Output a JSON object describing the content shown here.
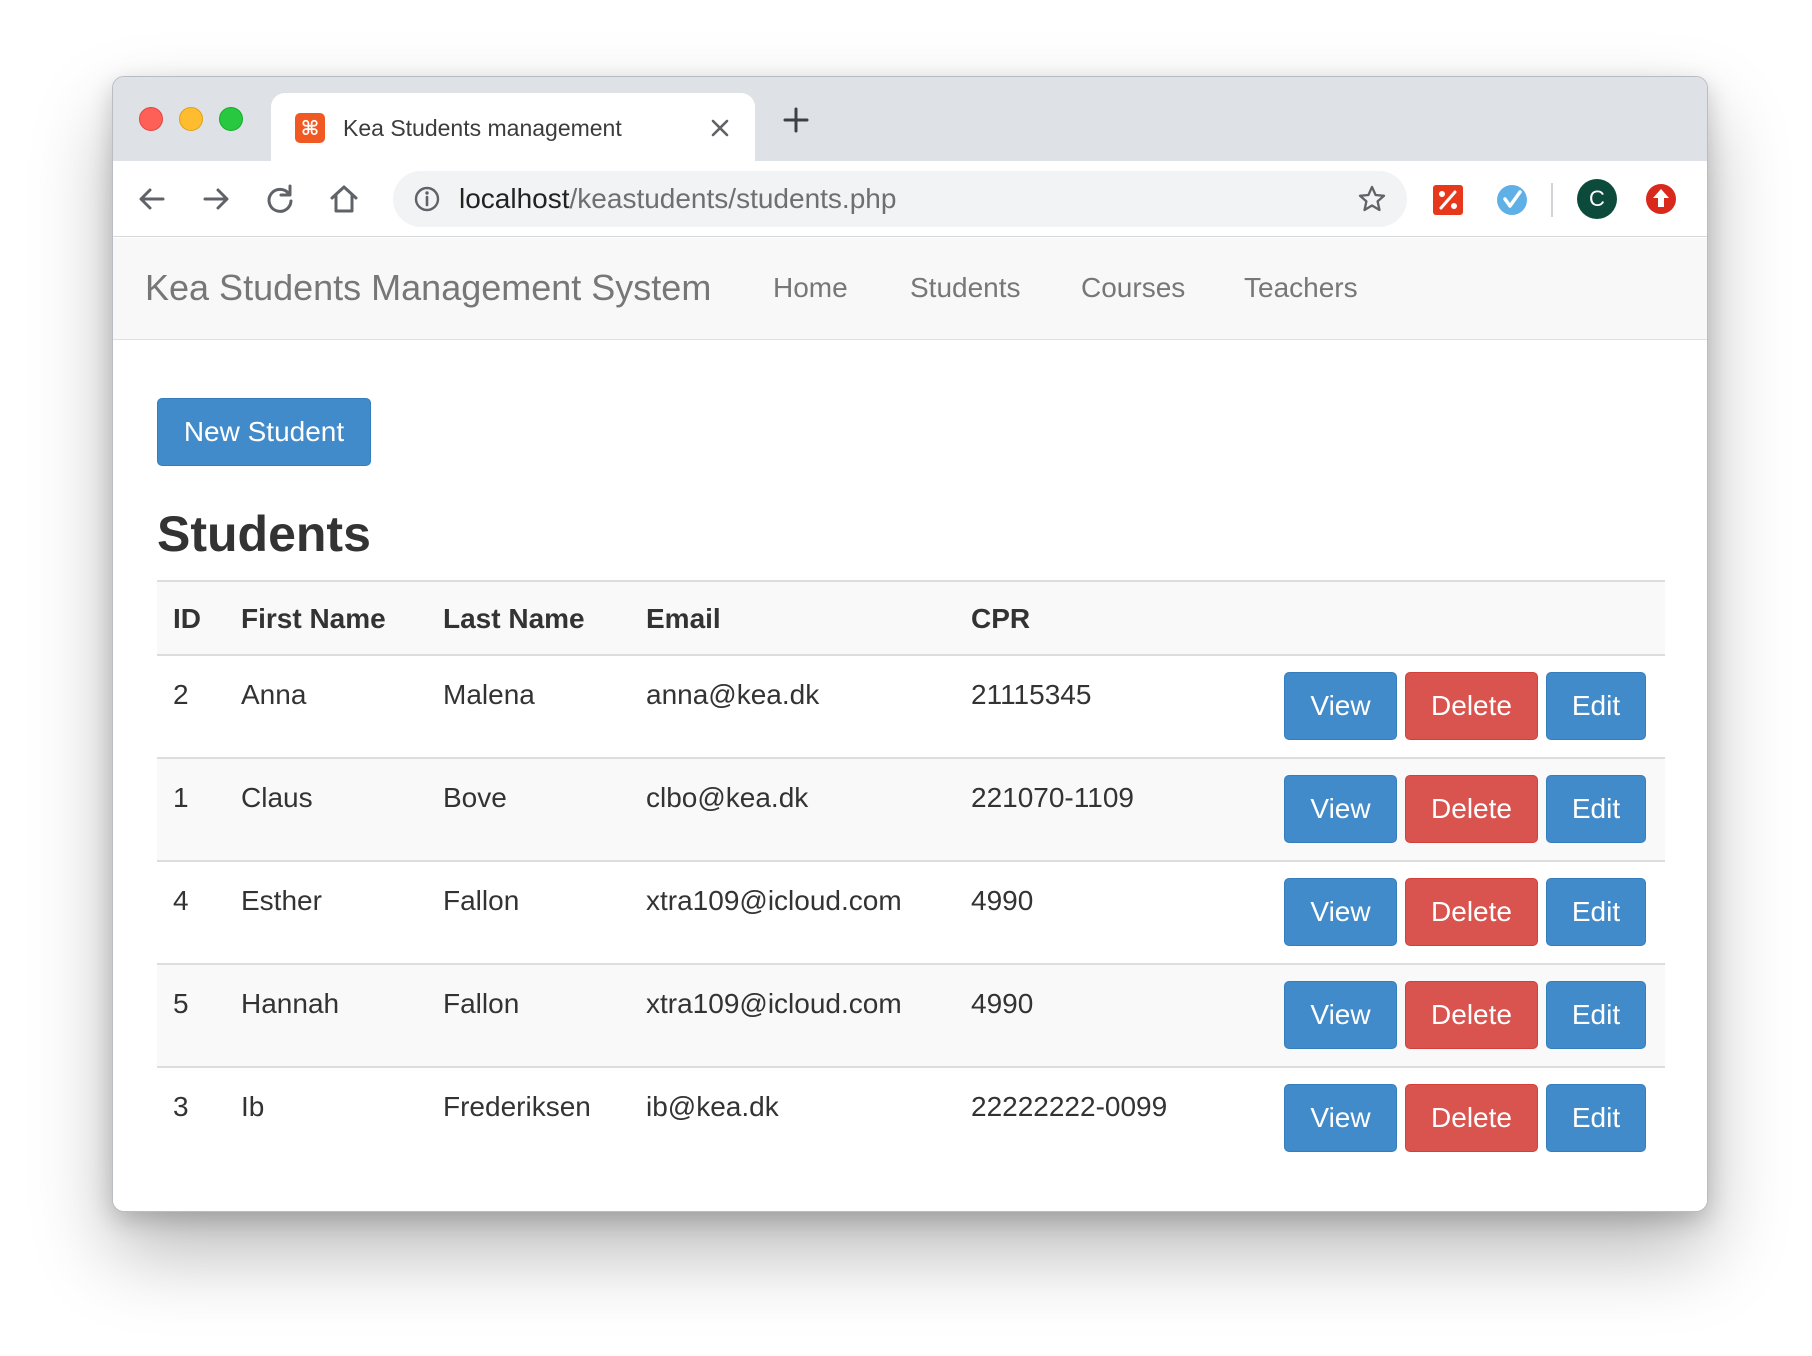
{
  "browser": {
    "tab_title": "Kea Students management",
    "favicon_glyph": "⌘",
    "url_host": "localhost",
    "url_path": "/keastudents/students.php",
    "avatar_letter": "C"
  },
  "navbar": {
    "brand": "Kea Students Management System",
    "links": [
      "Home",
      "Students",
      "Courses",
      "Teachers"
    ]
  },
  "actions": {
    "new_student": "New Student"
  },
  "page_title": "Students",
  "table": {
    "headers": [
      "ID",
      "First Name",
      "Last Name",
      "Email",
      "CPR"
    ],
    "rows": [
      {
        "id": "2",
        "first": "Anna",
        "last": "Malena",
        "email": "anna@kea.dk",
        "cpr": "21115345"
      },
      {
        "id": "1",
        "first": "Claus",
        "last": "Bove",
        "email": "clbo@kea.dk",
        "cpr": "221070-1109"
      },
      {
        "id": "4",
        "first": "Esther",
        "last": "Fallon",
        "email": "xtra109@icloud.com",
        "cpr": "4990"
      },
      {
        "id": "5",
        "first": "Hannah",
        "last": "Fallon",
        "email": "xtra109@icloud.com",
        "cpr": "4990"
      },
      {
        "id": "3",
        "first": "Ib",
        "last": "Frederiksen",
        "email": "ib@kea.dk",
        "cpr": "22222222-0099"
      }
    ],
    "row_buttons": {
      "view": "View",
      "delete": "Delete",
      "edit": "Edit"
    }
  },
  "colors": {
    "primary": "#428bca",
    "danger": "#d9534f",
    "navbar_bg": "#f8f8f8",
    "stripe": "#f9f9f9"
  },
  "icons": {
    "back": "back-arrow-icon",
    "forward": "forward-arrow-icon",
    "reload": "reload-icon",
    "home": "home-icon",
    "info": "info-icon",
    "star": "star-icon",
    "close": "close-icon",
    "plus": "plus-icon"
  }
}
